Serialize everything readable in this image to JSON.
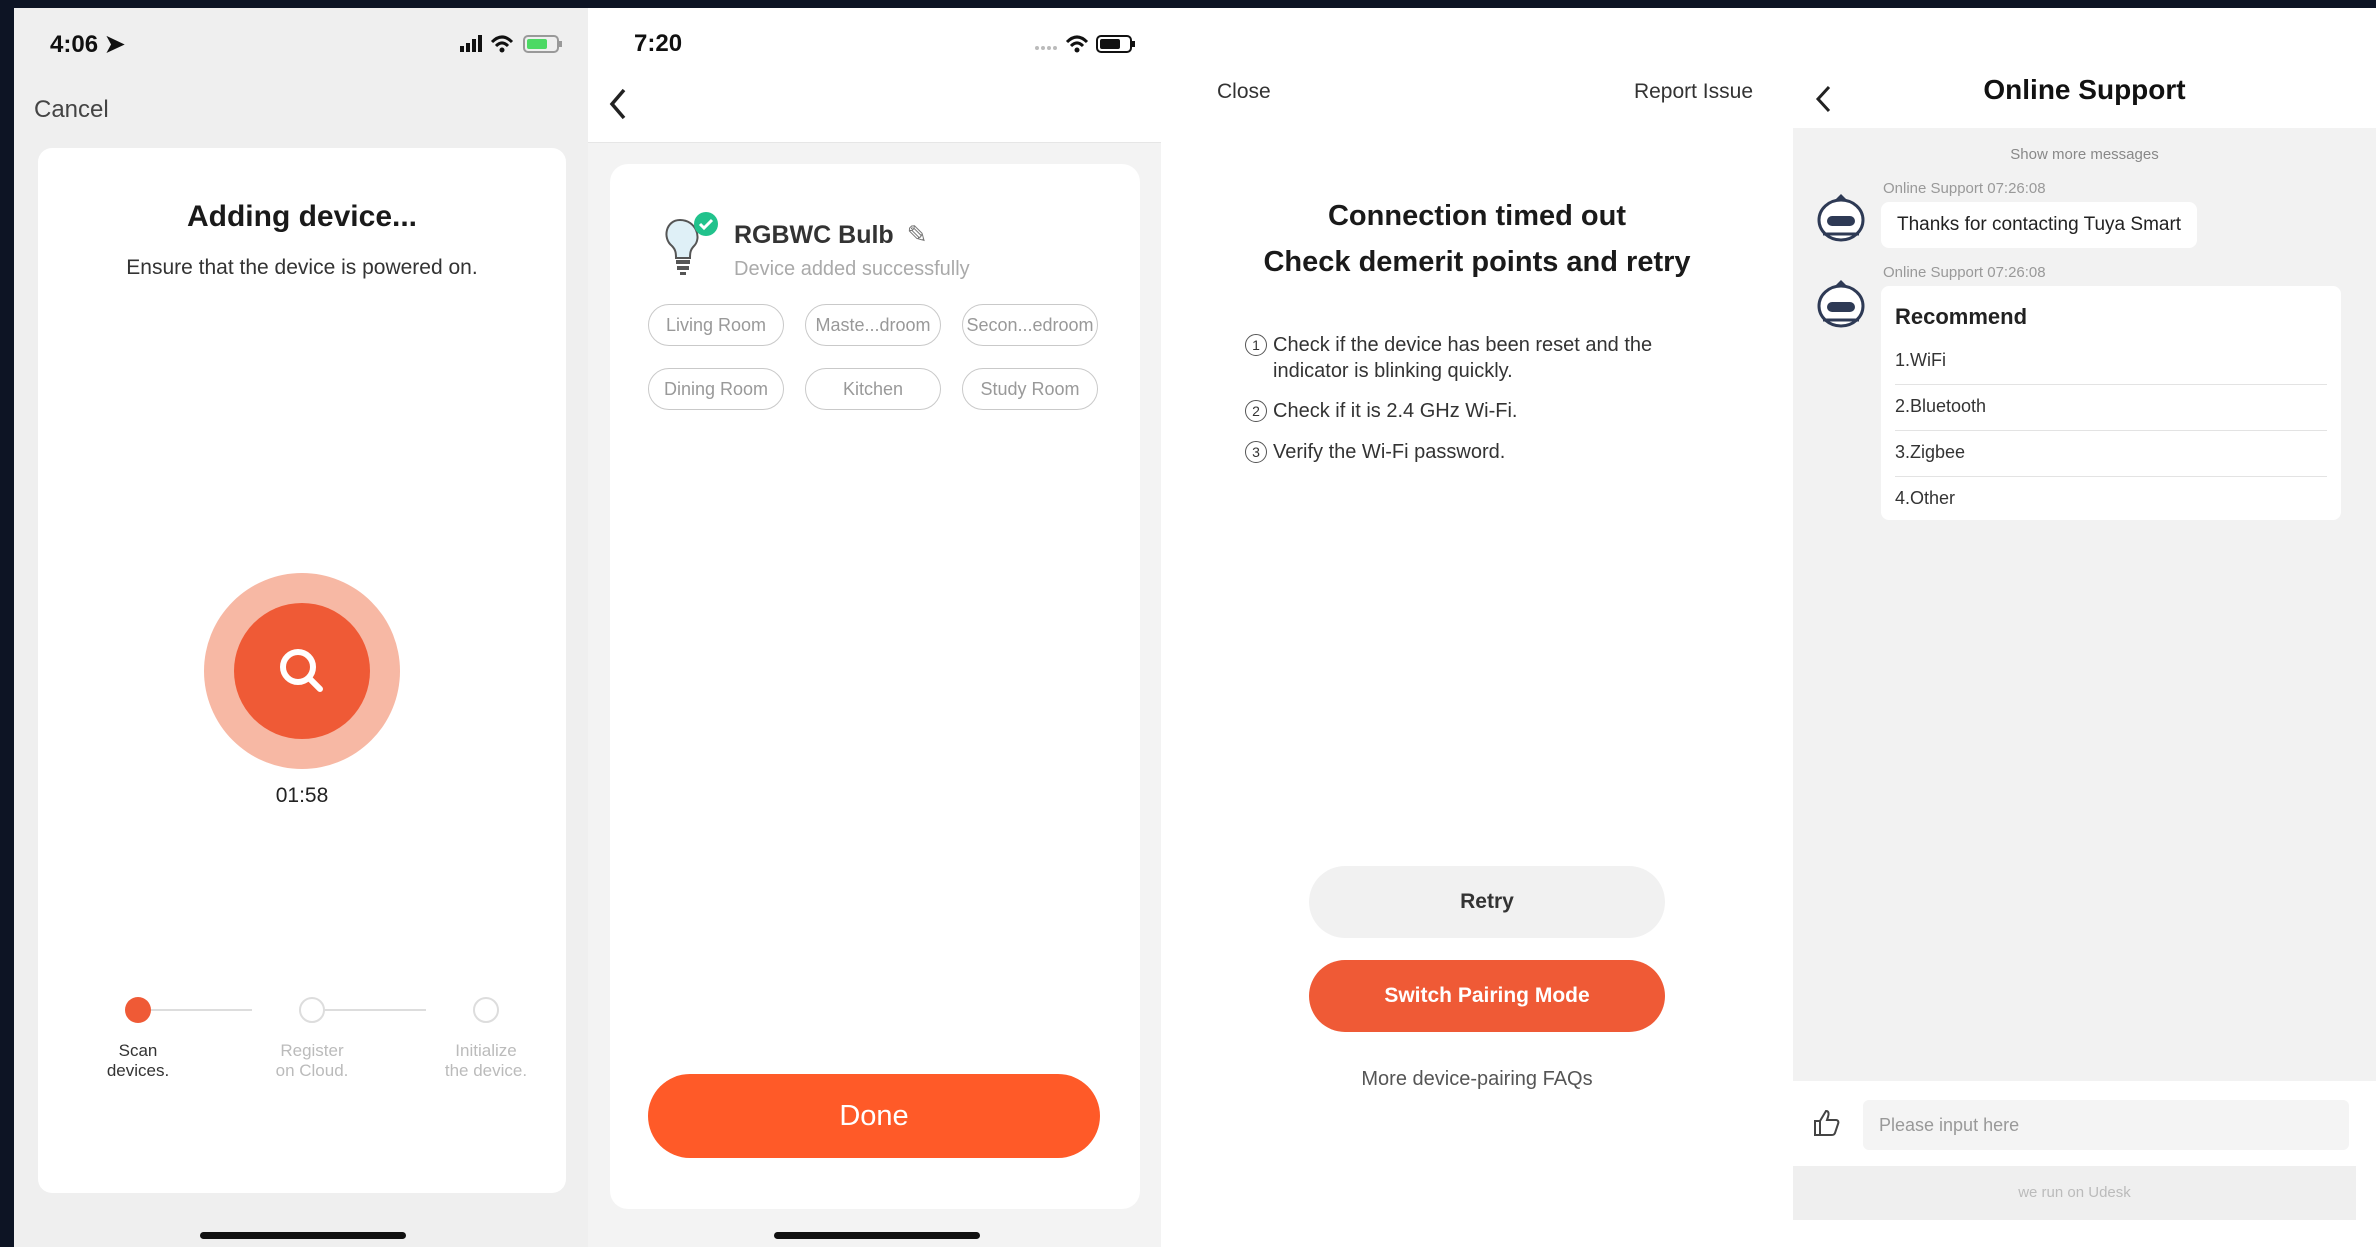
{
  "screen1": {
    "status_time": "4:06",
    "cancel_label": "Cancel",
    "title": "Adding device...",
    "subtitle": "Ensure that the device is powered on.",
    "timer": "01:58",
    "steps": [
      {
        "line1": "Scan",
        "line2": "devices.",
        "active": true
      },
      {
        "line1": "Register",
        "line2": "on Cloud.",
        "active": false
      },
      {
        "line1": "Initialize",
        "line2": "the device.",
        "active": false
      }
    ],
    "accent": "#ef5a36"
  },
  "screen2": {
    "status_time": "7:20",
    "device_name": "RGBWC Bulb",
    "device_status": "Device added successfully",
    "rooms": [
      "Living Room",
      "Maste...droom",
      "Secon...edroom",
      "Dining Room",
      "Kitchen",
      "Study Room"
    ],
    "done_label": "Done",
    "accent": "#ff5a28"
  },
  "screen3": {
    "close_label": "Close",
    "report_label": "Report Issue",
    "title_line1": "Connection timed out",
    "title_line2": "Check demerit points and retry",
    "tips": [
      {
        "num": "1",
        "text": "Check if the device has been reset and the indicator is blinking quickly."
      },
      {
        "num": "2",
        "text": "Check if it is 2.4 GHz Wi-Fi."
      },
      {
        "num": "3",
        "text": "Verify the Wi-Fi password."
      }
    ],
    "retry_label": "Retry",
    "switch_label": "Switch Pairing Mode",
    "faq_label": "More device-pairing FAQs"
  },
  "screen4": {
    "title": "Online Support",
    "show_more": "Show more messages",
    "msg1_meta": "Online Support   07:26:08",
    "msg1_text": "Thanks for contacting Tuya Smart",
    "msg2_meta": "Online Support   07:26:08",
    "recommend_title": "Recommend",
    "recommend_items": [
      "1.WiFi",
      "2.Bluetooth",
      "3.Zigbee",
      "4.Other"
    ],
    "input_placeholder": "Please input here",
    "footer": "we run on Udesk"
  }
}
